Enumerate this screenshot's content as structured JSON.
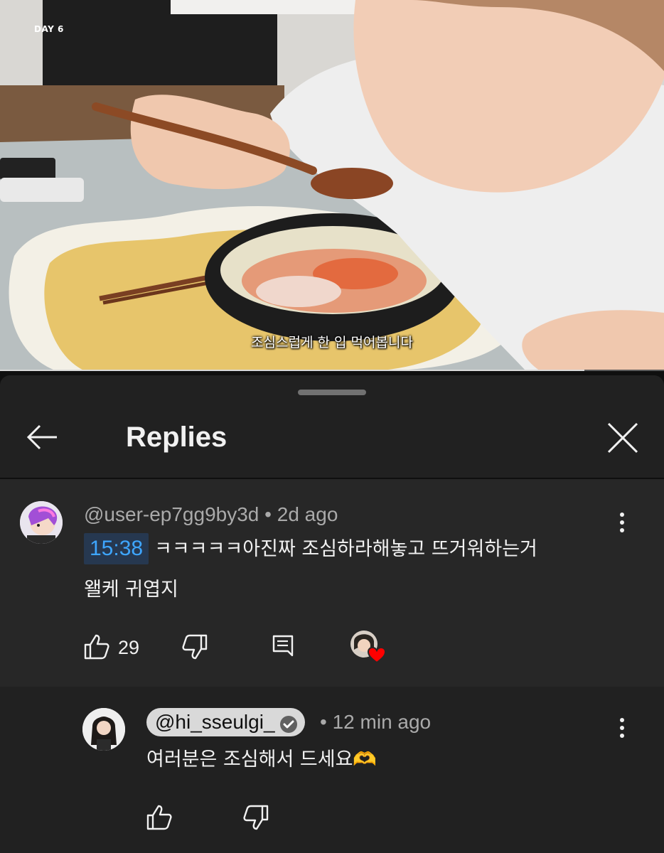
{
  "video": {
    "day_label": "DAY 6",
    "subtitle": "조심스럽게 한 입 먹어봅니다",
    "progress_fraction": 0.88
  },
  "panel": {
    "title": "Replies",
    "back_icon": "arrow-left-icon",
    "close_icon": "close-x-icon"
  },
  "parent_comment": {
    "author": "@user-ep7gg9by3d",
    "separator": "•",
    "time": "2d ago",
    "timestamp_link": "15:38",
    "text_line1": "ㅋㅋㅋㅋㅋ아진짜 조심하라해놓고 뜨거워하는거",
    "text_line2": "왤케 귀엽지",
    "likes": "29",
    "icons": [
      "thumb-up-icon",
      "thumb-down-icon",
      "reply-icon",
      "creator-heart-icon",
      "more-vert-icon"
    ]
  },
  "reply": {
    "author": "@hi_sseulgi_",
    "verified": true,
    "separator": "•",
    "time": "12 min ago",
    "text": "여러분은 조심해서 드세요🫶",
    "icons": [
      "thumb-up-icon",
      "thumb-down-icon",
      "more-vert-icon"
    ]
  },
  "colors": {
    "background": "#0f0f0f",
    "sheet": "#212121",
    "highlighted_comment": "#272727",
    "link_blue": "#3ea6ff",
    "heart_red": "#ff0000"
  }
}
